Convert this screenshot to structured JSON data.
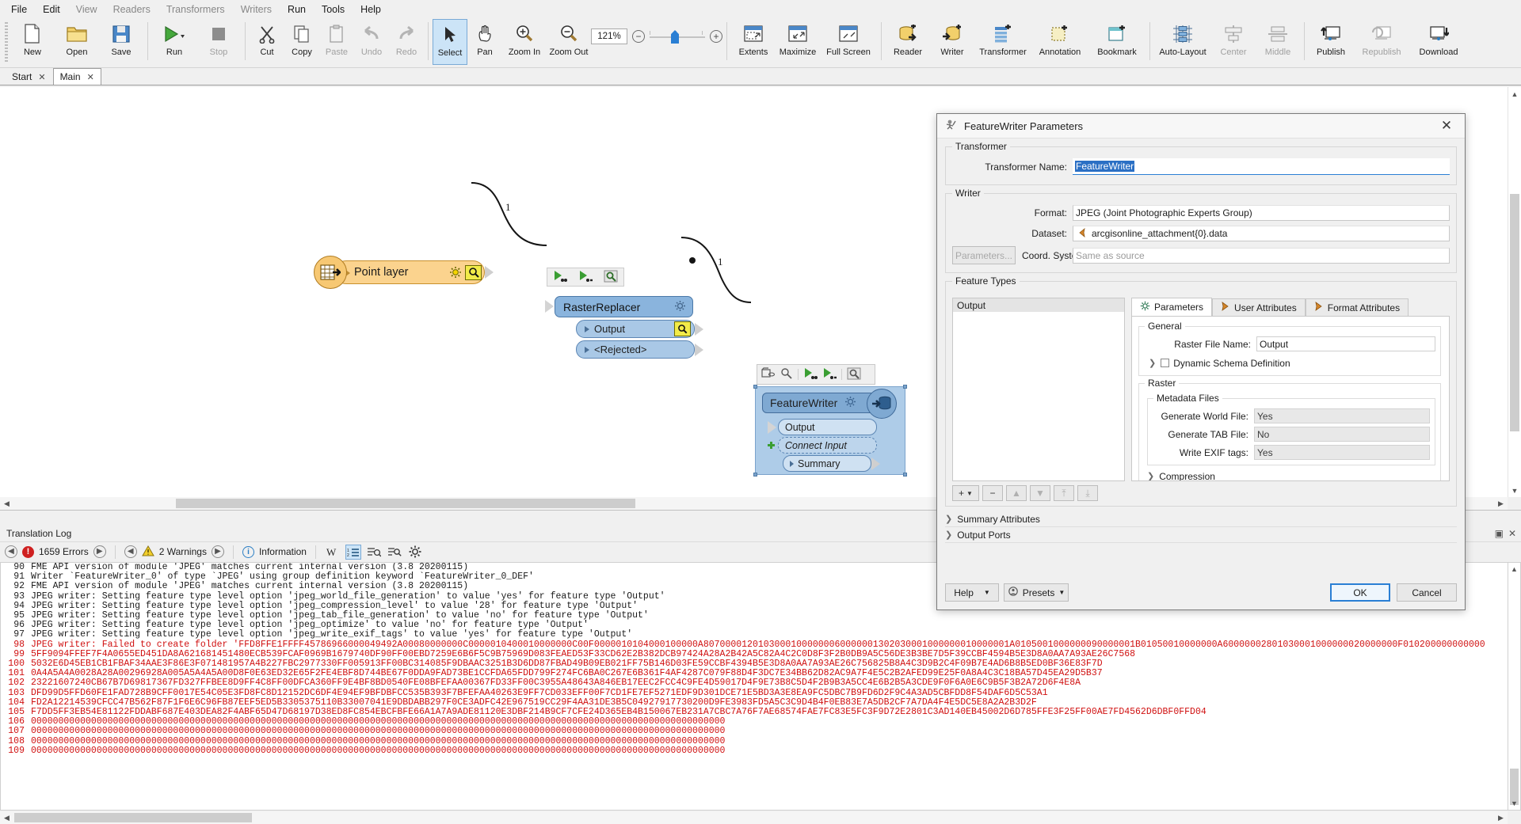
{
  "menubar": {
    "items": [
      {
        "label": "File",
        "dim": false
      },
      {
        "label": "Edit",
        "dim": false
      },
      {
        "label": "View",
        "dim": true
      },
      {
        "label": "Readers",
        "dim": true
      },
      {
        "label": "Transformers",
        "dim": true
      },
      {
        "label": "Writers",
        "dim": true
      },
      {
        "label": "Run",
        "dim": false
      },
      {
        "label": "Tools",
        "dim": false
      },
      {
        "label": "Help",
        "dim": false
      }
    ]
  },
  "toolbar": {
    "zoom_value": "121%",
    "zoom_out_label": "−",
    "zoom_in_label": "+",
    "groups": [
      {
        "buttons": [
          {
            "label": "New",
            "icon": "new-document-icon",
            "state": "normal"
          },
          {
            "label": "Open",
            "icon": "open-folder-icon",
            "state": "normal"
          },
          {
            "label": "Save",
            "icon": "save-disk-icon",
            "state": "normal"
          }
        ]
      },
      {
        "buttons": [
          {
            "label": "Run",
            "icon": "run-play-icon",
            "state": "normal"
          },
          {
            "label": "Stop",
            "icon": "stop-square-icon",
            "state": "disabled"
          }
        ]
      },
      {
        "buttons": [
          {
            "label": "Cut",
            "icon": "scissors-icon",
            "state": "normal"
          },
          {
            "label": "Copy",
            "icon": "copy-icon",
            "state": "normal"
          },
          {
            "label": "Paste",
            "icon": "clipboard-icon",
            "state": "disabled"
          },
          {
            "label": "Undo",
            "icon": "undo-arrow-icon",
            "state": "disabled"
          },
          {
            "label": "Redo",
            "icon": "redo-arrow-icon",
            "state": "disabled"
          }
        ]
      },
      {
        "buttons": [
          {
            "label": "Select",
            "icon": "cursor-arrow-icon",
            "state": "active"
          },
          {
            "label": "Pan",
            "icon": "hand-icon",
            "state": "normal"
          },
          {
            "label": "Zoom In",
            "icon": "zoom-in-magnifier-icon",
            "state": "normal"
          },
          {
            "label": "Zoom Out",
            "icon": "zoom-out-magnifier-icon",
            "state": "normal"
          }
        ]
      },
      {
        "buttons": [
          {
            "label": "Extents",
            "icon": "extents-icon",
            "state": "normal"
          },
          {
            "label": "Maximize",
            "icon": "maximize-icon",
            "state": "normal"
          },
          {
            "label": "Full Screen",
            "icon": "full-screen-icon",
            "state": "normal"
          }
        ]
      },
      {
        "buttons": [
          {
            "label": "Reader",
            "icon": "add-reader-icon",
            "state": "normal"
          },
          {
            "label": "Writer",
            "icon": "add-writer-icon",
            "state": "normal"
          },
          {
            "label": "Transformer",
            "icon": "add-transformer-icon",
            "state": "normal"
          },
          {
            "label": "Annotation",
            "icon": "add-annotation-icon",
            "state": "normal"
          },
          {
            "label": "Bookmark",
            "icon": "add-bookmark-icon",
            "state": "normal"
          }
        ]
      },
      {
        "buttons": [
          {
            "label": "Auto-Layout",
            "icon": "auto-layout-icon",
            "state": "normal"
          },
          {
            "label": "Center",
            "icon": "align-center-icon",
            "state": "disabled"
          },
          {
            "label": "Middle",
            "icon": "align-middle-icon",
            "state": "disabled"
          }
        ]
      },
      {
        "buttons": [
          {
            "label": "Publish",
            "icon": "publish-upload-icon",
            "state": "normal"
          },
          {
            "label": "Republish",
            "icon": "republish-icon",
            "state": "disabled"
          },
          {
            "label": "Download",
            "icon": "download-icon",
            "state": "normal"
          }
        ]
      }
    ]
  },
  "doctabs": [
    {
      "label": "Start",
      "selected": false,
      "close": "✕"
    },
    {
      "label": "Main",
      "selected": true,
      "close": "✕"
    }
  ],
  "canvas": {
    "reader_node": {
      "label": "Point layer",
      "gear_icon": "gear-icon",
      "inspect_icon": "magnifier-icon"
    },
    "raster_replacer": {
      "title": "RasterReplacer",
      "gear_icon": "gear-icon",
      "ports": [
        {
          "label": "Output",
          "inspect": true
        },
        {
          "label": "<Rejected>",
          "inspect": false
        }
      ]
    },
    "feature_writer": {
      "title": "FeatureWriter",
      "gear_icon": "gear-icon",
      "writer_icon": "database-write-icon",
      "ports": [
        {
          "label": "Output",
          "style": "solid"
        },
        {
          "label": "Connect Input",
          "style": "dashed"
        },
        {
          "label": "Summary",
          "style": "solid"
        }
      ],
      "float_toolbar_icons": [
        "group-folder-icon",
        "inspect-icon",
        "run-to-here-icon",
        "run-from-here-icon",
        "data-inspector-icon"
      ]
    },
    "connection_labels": [
      "1",
      "1"
    ]
  },
  "dialog": {
    "title": "FeatureWriter Parameters",
    "title_icon": "transformer-icon",
    "close_icon": "close-icon",
    "transformer_group": {
      "legend": "Transformer",
      "name_label": "Transformer Name:",
      "name_value": "FeatureWriter"
    },
    "writer_group": {
      "legend": "Writer",
      "parameters_button": "Parameters...",
      "format_label": "Format:",
      "format_value": "JPEG (Joint Photographic Experts Group)",
      "dataset_label": "Dataset:",
      "dataset_value": "arcgisonline_attachment{0}.data",
      "dataset_icon": "dataset-chevron-icon",
      "coordsys_label": "Coord. System:",
      "coordsys_placeholder": "Same as source"
    },
    "feature_types": {
      "legend": "Feature Types",
      "list_items": [
        "Output"
      ],
      "list_toolbar": [
        {
          "icon": "plus-icon",
          "label": "+",
          "caret": true,
          "disabled": false
        },
        {
          "icon": "minus-icon",
          "label": "−",
          "caret": false,
          "disabled": false
        },
        {
          "icon": "move-up-icon",
          "label": "▲",
          "caret": false,
          "disabled": true
        },
        {
          "icon": "move-down-icon",
          "label": "▼",
          "caret": false,
          "disabled": true
        },
        {
          "icon": "move-top-icon",
          "label": "⤒",
          "caret": false,
          "disabled": true
        },
        {
          "icon": "move-bottom-icon",
          "label": "⤓",
          "caret": false,
          "disabled": true
        }
      ],
      "tabs": [
        {
          "label": "Parameters",
          "icon": "gear-icon",
          "selected": true
        },
        {
          "label": "User Attributes",
          "icon": "attribute-arrow-icon",
          "selected": false
        },
        {
          "label": "Format Attributes",
          "icon": "attribute-arrow-icon",
          "selected": false
        }
      ],
      "general": {
        "legend": "General",
        "raster_file_name_label": "Raster File Name:",
        "raster_file_name_value": "Output",
        "dynamic_schema_label": "Dynamic Schema Definition",
        "dynamic_schema_checked": false
      },
      "raster": {
        "legend": "Raster",
        "metadata": {
          "legend": "Metadata Files",
          "rows": [
            {
              "label": "Generate World File:",
              "value": "Yes"
            },
            {
              "label": "Generate TAB File:",
              "value": "No"
            },
            {
              "label": "Write EXIF tags:",
              "value": "Yes"
            }
          ]
        },
        "compression_label": "Compression"
      }
    },
    "expanders": [
      "Summary Attributes",
      "Output Ports"
    ],
    "footer": {
      "help_label": "Help",
      "presets_label": "Presets",
      "presets_icon": "presets-icon",
      "ok_label": "OK",
      "cancel_label": "Cancel"
    }
  },
  "log": {
    "panel_title": "Translation Log",
    "errors_count": "1659 Errors",
    "warnings_count": "2 Warnings",
    "information_label": "Information",
    "errors_icon": "error-circle-icon",
    "warnings_icon": "warning-triangle-icon",
    "information_icon": "info-circle-icon",
    "nav_prev_icon": "arrow-left-icon",
    "nav_next_icon": "arrow-right-icon",
    "tool_icons": [
      "word-wrap-icon",
      "line-numbers-icon",
      "find-icon",
      "find-next-icon",
      "settings-gear-icon"
    ],
    "lines": [
      {
        "n": "90",
        "err": false,
        "text": "FME API version of module 'JPEG' matches current internal version (3.8 20200115)"
      },
      {
        "n": "91",
        "err": false,
        "text": "Writer `FeatureWriter_0' of type `JPEG' using group definition keyword `FeatureWriter_0_DEF'"
      },
      {
        "n": "92",
        "err": false,
        "text": "FME API version of module 'JPEG' matches current internal version (3.8 20200115)"
      },
      {
        "n": "93",
        "err": false,
        "text": "JPEG writer: Setting feature type level option 'jpeg_world_file_generation' to value 'yes' for feature type 'Output'"
      },
      {
        "n": "94",
        "err": false,
        "text": "JPEG writer: Setting feature type level option 'jpeg_compression_level' to value '28' for feature type 'Output'"
      },
      {
        "n": "95",
        "err": false,
        "text": "JPEG writer: Setting feature type level option 'jpeg_tab_file_generation' to value 'no' for feature type 'Output'"
      },
      {
        "n": "96",
        "err": false,
        "text": "JPEG writer: Setting feature type level option 'jpeg_optimize' to value 'no' for feature type 'Output'"
      },
      {
        "n": "97",
        "err": false,
        "text": "JPEG writer: Setting feature type level option 'jpeg_write_exif_tags' to value 'yes' for feature type 'Output'"
      },
      {
        "n": "98",
        "err": true,
        "text": "JPEG writer: Failed to create folder 'FFD8FFE1FFFF45786966000049492A00080000000C0000010400010000000C00F0000010104000100000A80700001201030001000000060000001302030001000000010000001A0105001000000090000001B01050010000000A60000002801030001000000020000000F010200000000000"
      },
      {
        "n": "99",
        "err": true,
        "text": "5FF9094FFEF7F4A0655ED451DA8A621681451480ECB539FCAF0969B1679740DF90FF00EBD7259E6B6F5C9B75969D083FEAED53F33CD62E2B382DCB97424A28A2B42A5C82A4C2C0D8F3F2B0DB9A5C56DE3B3BE7D5F39CCBF4594B5E3D8A0AA7A93AE26C7568"
      },
      {
        "n": "100",
        "err": true,
        "text": "5032E6D45EB1CB1FBAF34AAE3F86E3F071481957A4B227FBC2977330FF005913FF00BC314085F9DBAAC3251B3D6DD87FBAD49B09EB021FF75B146D03FE59CCBF4394B5E3D8A0AA7A93AE26C756825B8A4C3D9B2C4F09B7E4AD6B8B5ED0BF36E83F7D"
      },
      {
        "n": "101",
        "err": true,
        "text": "0A4A5A4A0028A28A00296928A005A5A4A5A00D8F0E63ED32E65F2FE4EBF8D744BE67F0DDA9FAD73BE1CCFDA65FDD799F274FC6BA0C267E6B361F4AF4287C079F88D4F3DC7E34BB62D82AC9A7F4E5C2B2AFED99E25F0A8A4C3C18BA57D45EA29D5B37"
      },
      {
        "n": "102",
        "err": true,
        "text": "23221607240CB67B7D69817367FD327FFBEE8D9FF4C8FF00DFCA360FF9E4BF8BD0540FE08BFEFAA00367FD33FF00C3955A48643A846EB17EEC2FCC4C9FE4D59017D4F9E73B8C5D4F2B9B3A5CC4E6B2B5A3CDE9F0F6A0E6C9B5F3B2A72D6F4E8A"
      },
      {
        "n": "103",
        "err": true,
        "text": "DFD99D5FFD60FE1FAD728B9CFF0017E54C05E3FD8FC8D12152DC6DF4E94EF9BFDBFCC535B393F7BFEFAA40263E9FF7CD033EFF00F7CD1FE7EF5271EDF9D301DCE71E5BD3A3E8EA9FC5DBC7B9FD6D2F9C4A3AD5CBFDD8F54DAF6D5C53A1"
      },
      {
        "n": "104",
        "err": true,
        "text": "FD2A12214539CFCC47B562F87F1F6E6C96FB87EEF5ED5B3305375110B33007041E9DBDABB297F0CE3ADFC42E967519CC29F4AA31DE3B5C04927917730200D9FE3983FD5A5C3C9D4B4F0EB83E7A5DB2CF7A7DA4F4E5DC5E8A2A2B3D2F"
      },
      {
        "n": "105",
        "err": true,
        "text": "F7DD5FF3EB54E81122FDDABF687E403DEA82F4ABF65D47D68197D38ED8FC854EBCFBFE66A1A7A9ADE81120E3DBF214B9CF7CFE24D365EB4B150067EB231A7CBC7A76F7AE68574FAE7FC83E5FC3F9D72E2801C3AD140EB45002D6D785FFE3F25FF00AE7FD4562D6DBF0FFD04"
      },
      {
        "n": "106",
        "err": true,
        "text": "0000000000000000000000000000000000000000000000000000000000000000000000000000000000000000000000000000000000000000000000000000000"
      },
      {
        "n": "107",
        "err": true,
        "text": "0000000000000000000000000000000000000000000000000000000000000000000000000000000000000000000000000000000000000000000000000000000"
      },
      {
        "n": "108",
        "err": true,
        "text": "0000000000000000000000000000000000000000000000000000000000000000000000000000000000000000000000000000000000000000000000000000000"
      },
      {
        "n": "109",
        "err": true,
        "text": "0000000000000000000000000000000000000000000000000000000000000000000000000000000000000000000000000000000000000000000000000000000"
      }
    ]
  }
}
